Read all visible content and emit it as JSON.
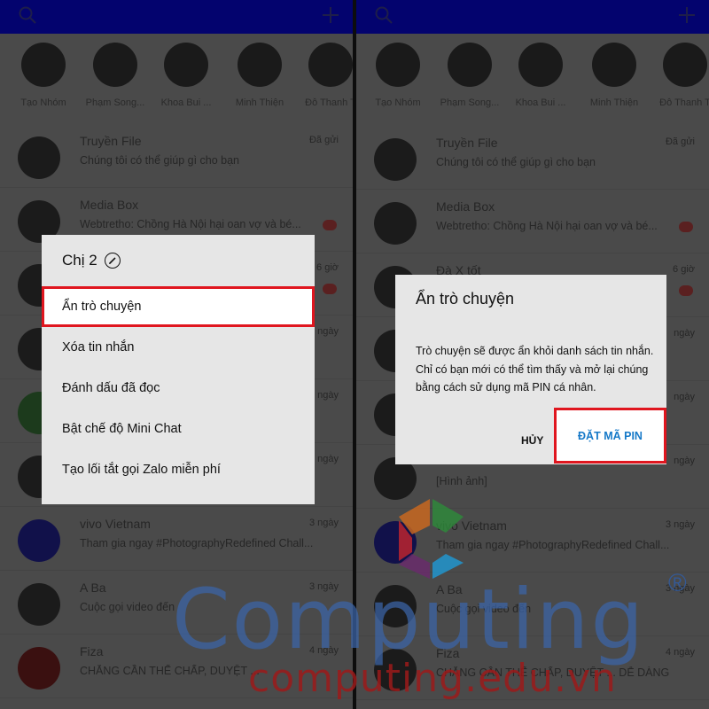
{
  "stories": [
    "Tạo Nhóm",
    "Phạm Song...",
    "Khoa Bui ...",
    "Minh Thiện",
    "Đỗ Thanh T"
  ],
  "left_rows": [
    {
      "name": "Truyền File",
      "msg": "Chúng tôi có thể giúp gì cho bạn",
      "time": "Đã gửi"
    },
    {
      "name": "Media Box",
      "msg": "Webtretho: Chồng Hà Nội hại oan vợ và bé...",
      "time": ""
    },
    {
      "name": "",
      "msg": "",
      "time": "6 giờ"
    },
    {
      "name": "",
      "msg": "",
      "time": "ngày"
    },
    {
      "name": "",
      "msg": "",
      "time": "ngày"
    },
    {
      "name": "",
      "msg": "",
      "time": "ngày"
    },
    {
      "name": "vivo Vietnam",
      "msg": "Tham gia ngay #PhotographyRedefined Chall...",
      "time": "3 ngày"
    },
    {
      "name": "A Ba",
      "msg": "Cuộc gọi video đến",
      "time": "3 ngày"
    },
    {
      "name": "Fiza",
      "msg": "CHẲNG CẦN THẾ CHẤP, DUYỆT ...",
      "time": "4 ngày"
    }
  ],
  "right_rows": [
    {
      "name": "Truyền File",
      "msg": "Chúng tôi có thể giúp gì cho bạn",
      "time": "Đã gửi"
    },
    {
      "name": "Media Box",
      "msg": "Webtretho: Chồng Hà Nội hại oan vợ và bé...",
      "time": ""
    },
    {
      "name": "Đà X tốt",
      "msg": "",
      "time": "6 giờ"
    },
    {
      "name": "",
      "msg": "",
      "time": "ngày"
    },
    {
      "name": "",
      "msg": "",
      "time": "ngày"
    },
    {
      "name": "",
      "msg": "[Hình ảnh]",
      "time": "ngày"
    },
    {
      "name": "vivo Vietnam",
      "msg": "Tham gia ngay #PhotographyRedefined Chall...",
      "time": "3 ngày"
    },
    {
      "name": "A Ba",
      "msg": "Cuộc gọi video đến",
      "time": "3 ngày"
    },
    {
      "name": "Fiza",
      "msg": "CHẲNG CẦN THẾ CHẤP, DUYỆT ... DỄ DÀNG",
      "time": "4 ngày"
    }
  ],
  "context_menu": {
    "title": "Chị 2",
    "items": [
      "Ẩn trò chuyện",
      "Xóa tin nhắn",
      "Đánh dấu đã đọc",
      "Bật chế độ Mini Chat",
      "Tạo lối tắt gọi Zalo miễn phí"
    ]
  },
  "dialog": {
    "title": "Ẩn trò chuyện",
    "body": "Trò chuyện sẽ được ẩn khỏi danh sách tin nhắn. Chỉ có bạn mới có thể tìm thấy và mở lại chúng bằng cách sử dụng mã PIN cá nhân.",
    "cancel": "HỦY",
    "ok": "ĐẶT MÃ PIN"
  },
  "watermark": {
    "brand": "Computing",
    "registered": "®",
    "url": "computing.edu.vn"
  },
  "colors": {
    "topbar": "#03036e",
    "highlight": "#e0161f",
    "link": "#1679c8"
  }
}
